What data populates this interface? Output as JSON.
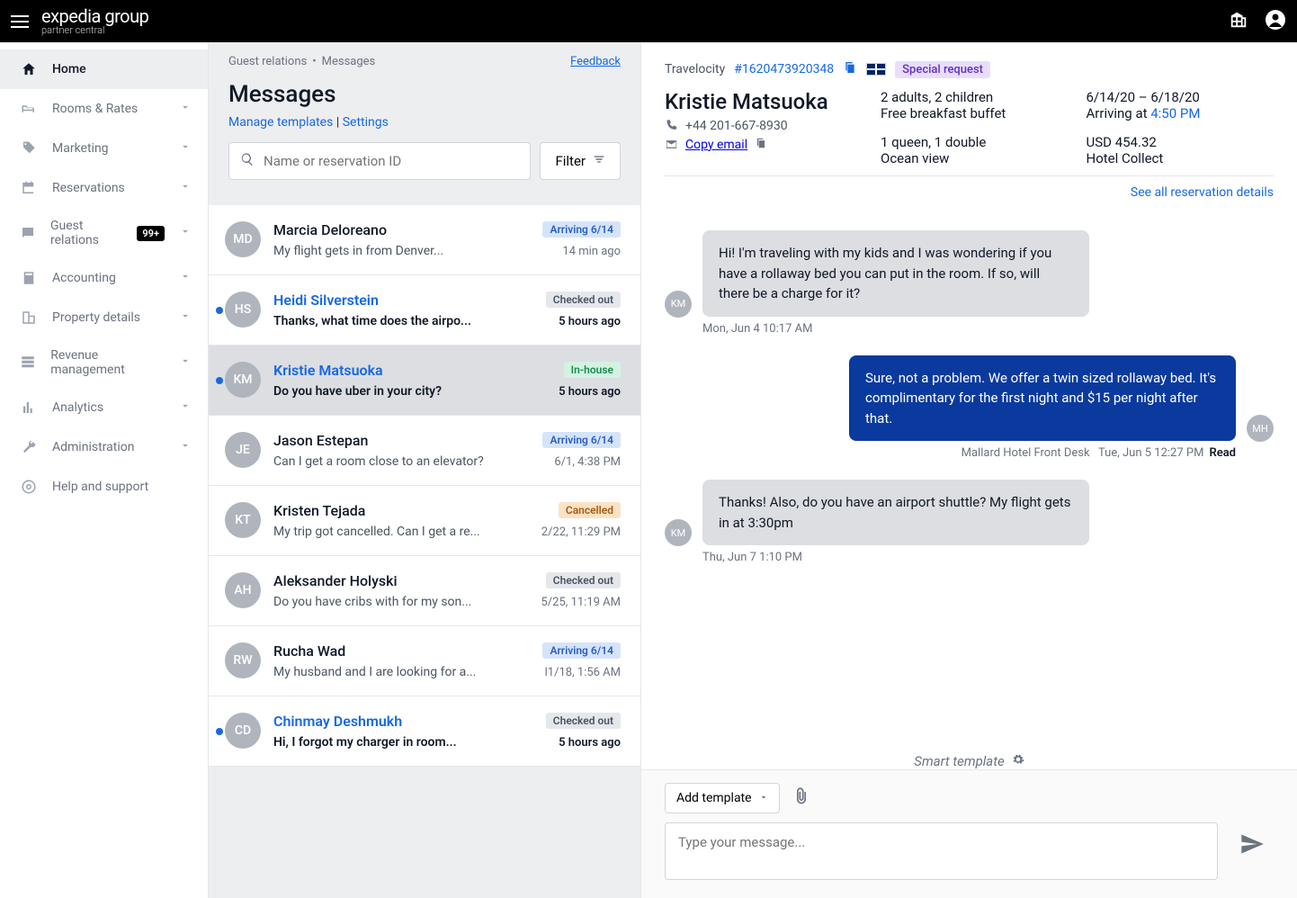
{
  "brand": {
    "main": "expedia group",
    "sub": "partner central"
  },
  "sidebar": {
    "items": [
      {
        "label": "Home"
      },
      {
        "label": "Rooms & Rates"
      },
      {
        "label": "Marketing"
      },
      {
        "label": "Reservations"
      },
      {
        "label": "Guest relations",
        "badge": "99+"
      },
      {
        "label": "Accounting"
      },
      {
        "label": "Property details"
      },
      {
        "label": "Revenue management"
      },
      {
        "label": "Analytics"
      },
      {
        "label": "Administration"
      },
      {
        "label": "Help and support"
      }
    ]
  },
  "breadcrumb": {
    "a": "Guest relations",
    "b": "Messages"
  },
  "feedback_label": "Feedback",
  "page_title": "Messages",
  "header_links": {
    "manage": "Manage templates",
    "sep": " | ",
    "settings": "Settings"
  },
  "search": {
    "placeholder": "Name or reservation ID"
  },
  "filter_label": "Filter",
  "conversations": [
    {
      "initials": "MD",
      "name": "Marcia Deloreano",
      "preview": "My flight gets in from Denver...",
      "status": "Arriving 6/14",
      "status_class": "pill-arriving",
      "time": "14 min ago",
      "unread": false
    },
    {
      "initials": "HS",
      "name": "Heidi Silverstein",
      "preview": "Thanks, what time does the airpo...",
      "status": "Checked out",
      "status_class": "pill-checkedout",
      "time": "5 hours ago",
      "unread": true
    },
    {
      "initials": "KM",
      "name": "Kristie Matsuoka",
      "preview": "Do you have uber in your city?",
      "status": "In-house",
      "status_class": "pill-inhouse",
      "time": "5 hours ago",
      "unread": true,
      "selected": true
    },
    {
      "initials": "JE",
      "name": "Jason Estepan",
      "preview": "Can I get a room close to an elevator?",
      "status": "Arriving 6/14",
      "status_class": "pill-arriving",
      "time": "6/1, 4:38 PM",
      "unread": false
    },
    {
      "initials": "KT",
      "name": "Kristen Tejada",
      "preview": "My trip got cancelled. Can I get a re...",
      "status": "Cancelled",
      "status_class": "pill-cancelled",
      "time": "2/22, 11:29 PM",
      "unread": false
    },
    {
      "initials": "AH",
      "name": "Aleksander Holyski",
      "preview": "Do you have cribs with for my son...",
      "status": "Checked out",
      "status_class": "pill-checkedout",
      "time": "5/25, 11:19 AM",
      "unread": false
    },
    {
      "initials": "RW",
      "name": "Rucha Wad",
      "preview": "My husband and I are looking for a...",
      "status": "Arriving 6/14",
      "status_class": "pill-arriving",
      "time": "l1/18, 1:56 AM",
      "unread": false
    },
    {
      "initials": "CD",
      "name": "Chinmay Deshmukh",
      "preview": "Hi, I forgot my charger in room...",
      "status": "Checked out",
      "status_class": "pill-checkedout",
      "time": "5 hours ago",
      "unread": true
    }
  ],
  "reservation": {
    "source": "Travelocity",
    "id": "#1620473920348",
    "special": "Special request",
    "guest_name": "Kristie Matsuoka",
    "phone": "+44 201-667-8930",
    "copy_email": "Copy email",
    "occupancy": "2 adults, 2 children",
    "meal": "Free breakfast buffet",
    "beds": "1 queen, 1 double",
    "view": "Ocean view",
    "dates": "6/14/20 – 6/18/20",
    "arriving_label": "Arriving at ",
    "arriving_time": "4:50 PM",
    "price": "USD 454.32",
    "collect": "Hotel Collect",
    "see_all": "See all reservation details"
  },
  "messages": [
    {
      "dir": "in",
      "initials": "KM",
      "text": "Hi! I'm traveling with my kids and I was wondering if you have a rollaway bed you can put in the room. If so, will there be a charge for it?",
      "meta": "Mon, Jun 4 10:17 AM"
    },
    {
      "dir": "out",
      "initials": "MH",
      "text": "Sure, not a problem. We offer a twin sized rollaway bed. It's complimentary for the first night and $15 per night after that.",
      "sender": "Mallard Hotel Front Desk",
      "meta": "Tue, Jun 5 12:27 PM",
      "read": "Read"
    },
    {
      "dir": "in",
      "initials": "KM",
      "text": "Thanks! Also, do you have an airport shuttle? My flight gets in at 3:30pm",
      "meta": "Thu, Jun 7 1:10 PM"
    }
  ],
  "smart_template_label": "Smart template",
  "compose": {
    "add_template": "Add template",
    "placeholder": "Type your message..."
  }
}
